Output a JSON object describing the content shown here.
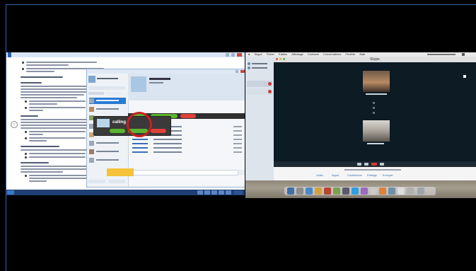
{
  "windows": {
    "skype_popup": {
      "caller_label": "calling"
    }
  },
  "mac": {
    "menubar": [
      "Skype",
      "Ficher",
      "Edition",
      "Affichage",
      "Contacts",
      "Conversations",
      "Fenêtre",
      "Aide"
    ],
    "call_window": {
      "title": "Skype",
      "tabs": [
        "Vidéo",
        "Appel",
        "Conférence",
        "Partage",
        "Envoyer"
      ]
    }
  },
  "colors": {
    "accent": "#2b7bd4",
    "call_green": "#5bb52e",
    "call_red": "#e0413a",
    "highlight_circle": "#cc1f1f",
    "taskbar": "#1f3f75"
  }
}
